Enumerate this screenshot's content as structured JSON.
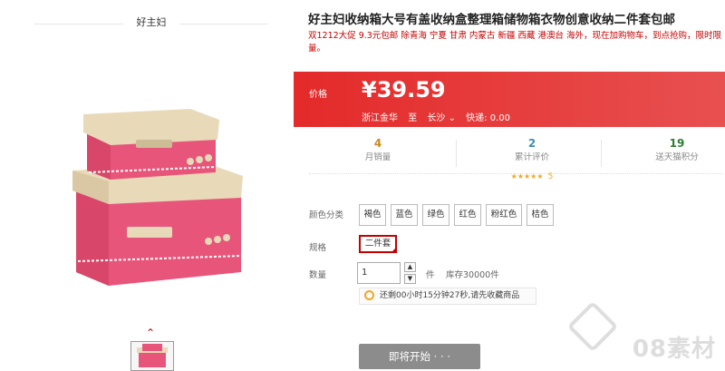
{
  "brand": "好主妇",
  "product": {
    "title": "好主妇收纳箱大号有盖收纳盒整理箱储物箱衣物创意收纳二件套包邮",
    "subtitle": "双1212大促 9.3元包邮 除青海 宁夏 甘肃 内蒙古 新疆 西藏 港澳台 海外，现在加购物车，到点抢购，限时限量。"
  },
  "price": {
    "label": "价格",
    "value": "¥39.59",
    "origin": "浙江金华",
    "to": "至",
    "destination": "长沙",
    "shipping": "快递: 0.00"
  },
  "stats": [
    {
      "num": "4",
      "label": "月销量",
      "color": "#c98a20"
    },
    {
      "num": "2",
      "label": "累计评价",
      "color": "#3a8fb7",
      "stars": "★★★★★",
      "star_count": "5"
    },
    {
      "num": "19",
      "label": "送天猫积分",
      "color": "#2e7d32"
    }
  ],
  "options": {
    "color_label": "颜色分类",
    "colors": [
      "褐色",
      "蓝色",
      "绿色",
      "红色",
      "粉红色",
      "桔色"
    ],
    "spec_label": "规格",
    "spec_selected": "二件套",
    "qty_label": "数量",
    "qty_value": "1",
    "unit": "件",
    "stock": "库存30000件",
    "tip": "还剩00小时15分钟27秒,请先收藏商品"
  },
  "buy": {
    "label": "即将开始 · · ·"
  },
  "watermark": "08素材",
  "accent": "#e4393c"
}
